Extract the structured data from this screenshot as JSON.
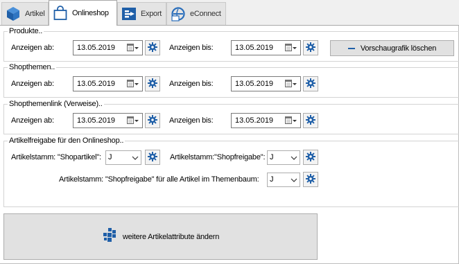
{
  "tabs": [
    {
      "label": "Artikel",
      "icon": "cube-icon"
    },
    {
      "label": "Onlineshop",
      "icon": "shopping-bag-icon"
    },
    {
      "label": "Export",
      "icon": "export-icon"
    },
    {
      "label": "eConnect",
      "icon": "econnect-icon"
    }
  ],
  "produkte": {
    "title": "Produkte..",
    "from_label": "Anzeigen ab:",
    "from_value": "13.05.2019",
    "to_label": "Anzeigen bis:",
    "to_value": "13.05.2019",
    "preview_button": "Vorschaugrafik löschen"
  },
  "shopthemen": {
    "title": "Shopthemen..",
    "from_label": "Anzeigen ab:",
    "from_value": "13.05.2019",
    "to_label": "Anzeigen bis:",
    "to_value": "13.05.2019"
  },
  "shopthemenlink": {
    "title": "Shopthemenlink (Verweise)..",
    "from_label": "Anzeigen ab:",
    "from_value": "13.05.2019",
    "to_label": "Anzeigen bis:",
    "to_value": "13.05.2019"
  },
  "freigabe": {
    "title": "Artikelfreigabe für den Onlineshop..",
    "shopartikel_label": "Artikelstamm: \"Shopartikel\":",
    "shopartikel_value": "J",
    "shopfreigabe_label": "Artikelstamm:\"Shopfreigabe\":",
    "shopfreigabe_value": "J",
    "alle_label": "Artikelstamm: \"Shopfreigabe\" für alle Artikel im Themenbaum:",
    "alle_value": "J"
  },
  "attribute_button": "weitere Artikelattribute ändern",
  "colors": {
    "gear_blue": "#1f5fa8",
    "accent_blue": "#2a6ebb"
  }
}
